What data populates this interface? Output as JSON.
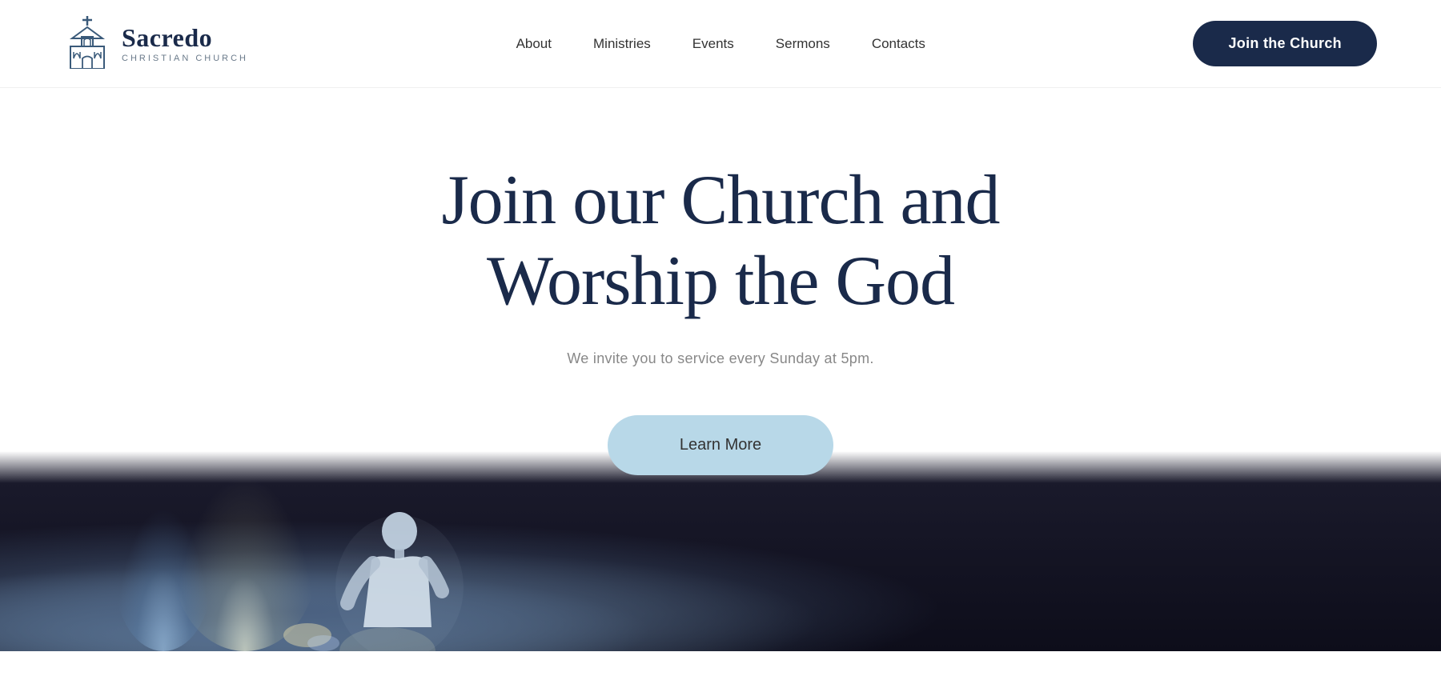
{
  "header": {
    "logo": {
      "name": "Sacredo",
      "subtitle": "CHRISTIAN CHURCH"
    },
    "nav": {
      "items": [
        {
          "label": "About",
          "href": "#"
        },
        {
          "label": "Ministries",
          "href": "#"
        },
        {
          "label": "Events",
          "href": "#"
        },
        {
          "label": "Sermons",
          "href": "#"
        },
        {
          "label": "Contacts",
          "href": "#"
        }
      ]
    },
    "cta_button": "Join the Church"
  },
  "hero": {
    "title_line1": "Join our Church and",
    "title_line2": "Worship the God",
    "subtitle": "We invite you to service every Sunday at 5pm.",
    "learn_more_label": "Learn More"
  },
  "colors": {
    "navy": "#1a2a4a",
    "light_blue_btn": "#b8d8e8",
    "text_gray": "#888888"
  }
}
